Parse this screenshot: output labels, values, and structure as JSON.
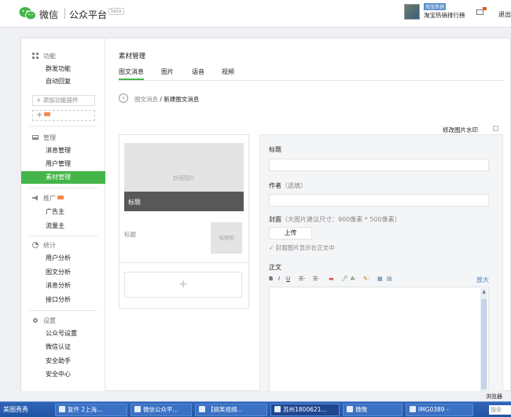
{
  "header": {
    "logo_text": "微信",
    "logo_sub": "公众平台",
    "beta": "beta",
    "account_tag": "淘宝热销",
    "account_name": "淘宝热销排行榜",
    "logout": "退出"
  },
  "sidebar": {
    "sections": [
      {
        "title": "功能",
        "icon": "grid-icon",
        "items": [
          "群发功能",
          "自动回复"
        ]
      },
      {
        "title": "管理",
        "icon": "manage-icon",
        "items": [
          "消息管理",
          "用户管理",
          "素材管理"
        ]
      },
      {
        "title": "推广",
        "icon": "megaphone-icon",
        "items": [
          "广告主",
          "流量主"
        ]
      },
      {
        "title": "统计",
        "icon": "stats-icon",
        "items": [
          "用户分析",
          "图文分析",
          "消息分析",
          "接口分析"
        ]
      },
      {
        "title": "设置",
        "icon": "gear-icon",
        "items": [
          "公众号设置",
          "微信认证",
          "安全助手",
          "安全中心"
        ]
      }
    ],
    "add_plugin": "+ 添加功能插件",
    "add_plus": "+",
    "active_item": "素材管理"
  },
  "main": {
    "title": "素材管理",
    "tabs": [
      "图文消息",
      "图片",
      "语音",
      "视频"
    ],
    "active_tab": "图文消息",
    "breadcrumb_parent": "图文消息",
    "breadcrumb_sep": " / ",
    "breadcrumb_current": "新建图文消息",
    "watermark_label": "修改图片水印"
  },
  "preview": {
    "cover_placeholder": "封面图片",
    "cover_title": "标题",
    "item2_title": "标题",
    "thumb_label": "缩略图",
    "add_plus": "+"
  },
  "editor": {
    "title_label": "标题",
    "author_label": "作者",
    "author_hint": "（选填）",
    "cover_label": "封面",
    "cover_hint": "（大图片建议尺寸：900像素 * 500像素）",
    "upload": "上传",
    "cover_show": "✓  封面图片显示在正文中",
    "body_label": "正文",
    "expand": "放大",
    "toolbar": [
      "B",
      "I",
      "U",
      "☰·",
      "☰·",
      "▬",
      "🖊",
      "A·",
      "✎·",
      "▦",
      "▤"
    ]
  },
  "browser": {
    "mode": "浏览器"
  },
  "taskbar": {
    "start": "美图秀秀",
    "tasks": [
      "复件 2上海...",
      "微信公众平...",
      "【搞笑视频...",
      "苏州1800621...",
      "微微",
      "IMG0389 -"
    ],
    "search": "搜索"
  },
  "colors": {
    "accent_green": "#44b549",
    "taskbar_blue": "#2254a4"
  }
}
